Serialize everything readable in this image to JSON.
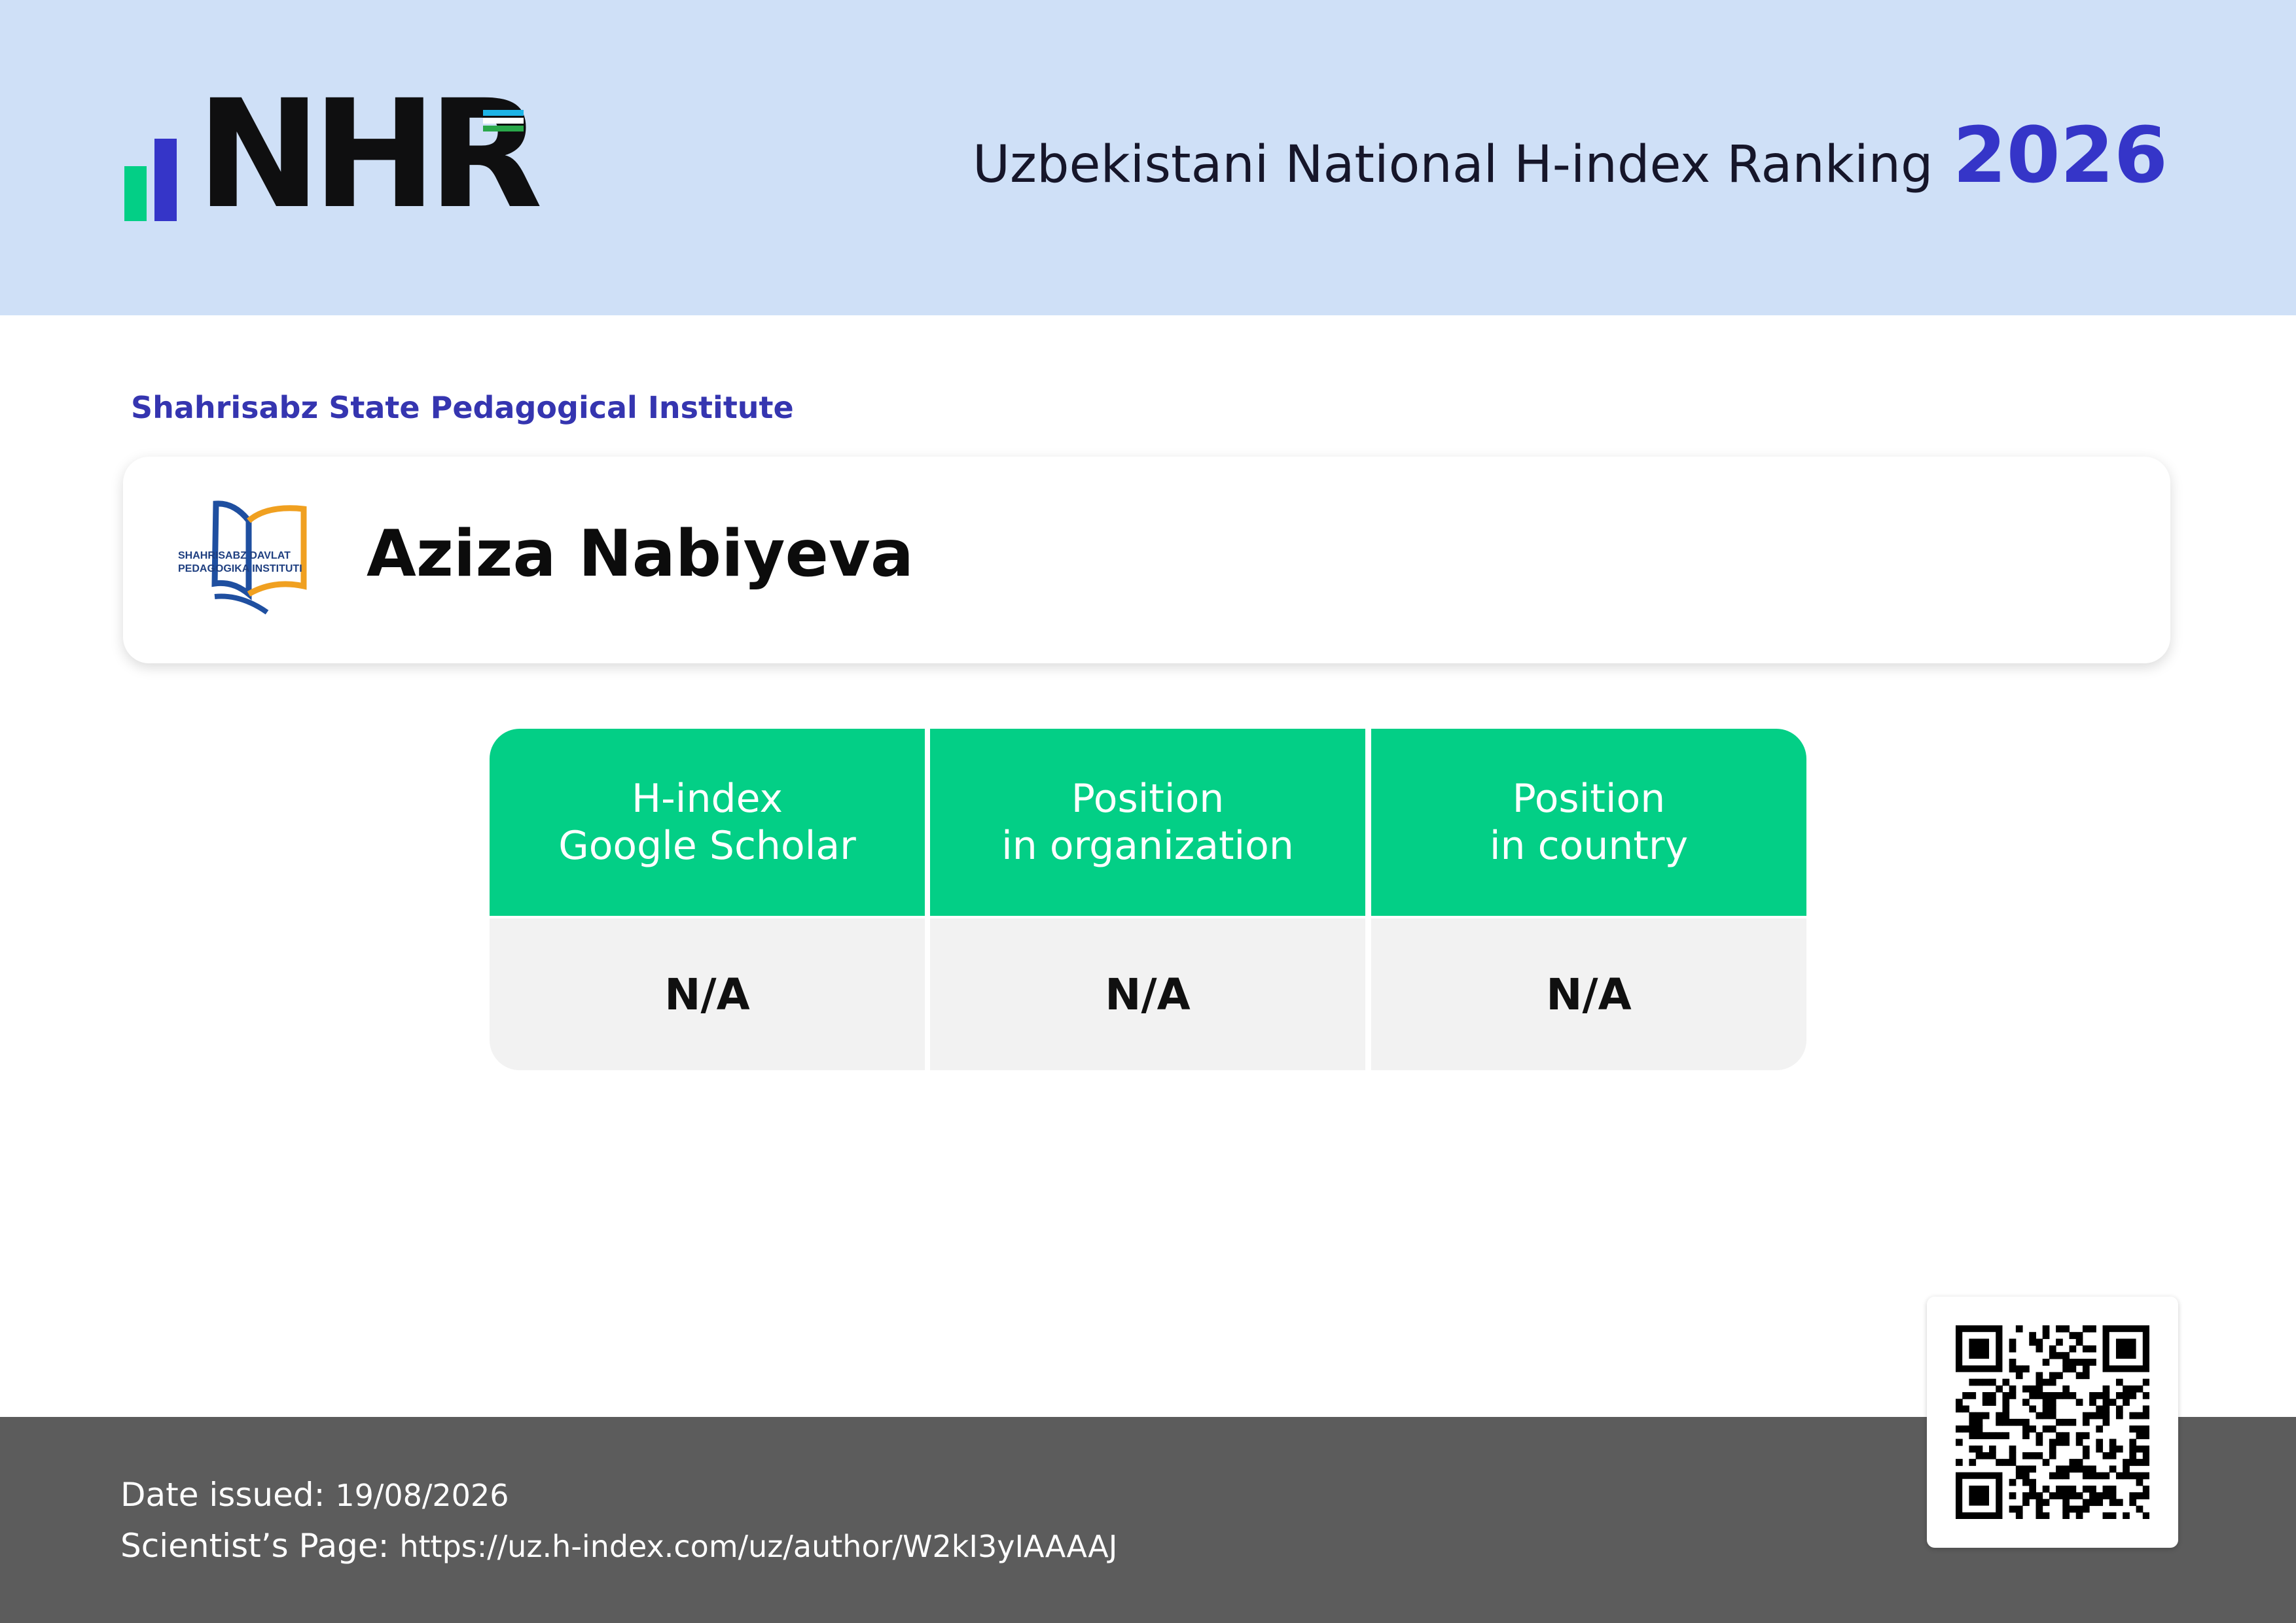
{
  "header": {
    "logo_text": "NHR",
    "title": "Uzbekistani National H-index Ranking",
    "year": "2026"
  },
  "institution": {
    "name": "Shahrisabz State Pedagogical Institute",
    "logo_text_line1": "SHAHRISABZ DAVLAT",
    "logo_text_line2": "PEDAGOGIKA INSTITUTI"
  },
  "scientist": {
    "name": "Aziza Nabiyeva"
  },
  "stats": [
    {
      "line1": "H-index",
      "line2": "Google Scholar",
      "value": "N/A"
    },
    {
      "line1": "Position",
      "line2": "in organization",
      "value": "N/A"
    },
    {
      "line1": "Position",
      "line2": "in country",
      "value": "N/A"
    }
  ],
  "footer": {
    "date_label": "Date issued:",
    "date_value": "19/08/2026",
    "page_label": "Scientist’s Page:",
    "page_url": "https://uz.h-index.com/uz/author/W2kI3yIAAAAJ"
  },
  "colors": {
    "header_bg": "#cfe0f7",
    "accent_blue": "#3535c8",
    "accent_green": "#03cf86",
    "footer_bg": "#5c5c5c"
  }
}
